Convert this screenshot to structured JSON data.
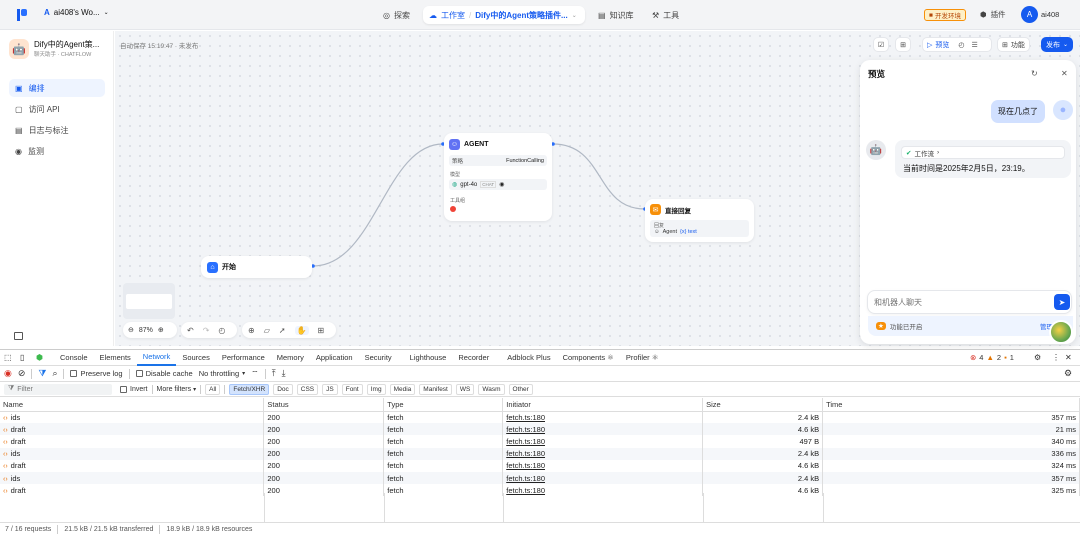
{
  "topbar": {
    "workspace_initial": "A",
    "workspace_name": "ai408's Wo...",
    "nav": [
      {
        "label": "探索"
      },
      {
        "label": "工作室"
      },
      {
        "label": "Dify中的Agent策略插件..."
      },
      {
        "label": "知识库"
      },
      {
        "label": "工具"
      }
    ],
    "env_badge": "开发环境",
    "plugin_label": "插件",
    "user_initial": "A",
    "user_name": "ai408"
  },
  "sidebar": {
    "app_name": "Dify中的Agent策...",
    "app_meta": "聊天助手 · CHATFLOW",
    "items": [
      {
        "label": "编排"
      },
      {
        "label": "访问 API"
      },
      {
        "label": "日志与标注"
      },
      {
        "label": "监测"
      }
    ]
  },
  "canvas": {
    "autosave": "自动保存 15:19:47 · 未发布",
    "toolbar": {
      "preview": "预览",
      "features": "功能",
      "publish": "发布"
    },
    "zoom": "87%",
    "start_node": {
      "title": "开始"
    },
    "agent_node": {
      "title": "AGENT",
      "strategy_label": "策略",
      "strategy_value": "FunctionCalling",
      "model_label": "模型",
      "model_name": "gpt-4o",
      "model_tag": "CHAT",
      "tools_label": "工具组"
    },
    "answer_node": {
      "title": "直接回复",
      "reply_label": "回复",
      "reply_source": "Agent",
      "reply_var": "{x} text"
    }
  },
  "preview": {
    "title": "预览",
    "user_message": "现在几点了",
    "workflow_label": "工作流",
    "bot_reply": "当前时间是2025年2月5日，23:19。",
    "input_placeholder": "和机器人聊天",
    "features_status": "功能已开启",
    "manage_label": "管理"
  },
  "devtools": {
    "tabs": [
      "Console",
      "Elements",
      "Network",
      "Sources",
      "Performance",
      "Memory",
      "Application",
      "Security",
      "Lighthouse",
      "Recorder",
      "Adblock Plus",
      "Components ⚛",
      "Profiler ⚛"
    ],
    "errors": "4",
    "warnings": "2",
    "info": "1",
    "toolbar": {
      "preserve_log": "Preserve log",
      "disable_cache": "Disable cache",
      "throttling": "No throttling"
    },
    "filter": {
      "placeholder": "Filter",
      "invert": "Invert",
      "more_filters": "More filters",
      "chips": [
        "All",
        "Fetch/XHR",
        "Doc",
        "CSS",
        "JS",
        "Font",
        "Img",
        "Media",
        "Manifest",
        "WS",
        "Wasm",
        "Other"
      ]
    },
    "columns": [
      "Name",
      "Status",
      "Type",
      "Initiator",
      "Size",
      "Time"
    ],
    "rows": [
      [
        "ids",
        "200",
        "fetch",
        "fetch.ts:180",
        "2.4 kB",
        "357 ms"
      ],
      [
        "draft",
        "200",
        "fetch",
        "fetch.ts:180",
        "4.6 kB",
        "21 ms"
      ],
      [
        "draft",
        "200",
        "fetch",
        "fetch.ts:180",
        "497 B",
        "340 ms"
      ],
      [
        "ids",
        "200",
        "fetch",
        "fetch.ts:180",
        "2.4 kB",
        "336 ms"
      ],
      [
        "draft",
        "200",
        "fetch",
        "fetch.ts:180",
        "4.6 kB",
        "324 ms"
      ],
      [
        "ids",
        "200",
        "fetch",
        "fetch.ts:180",
        "2.4 kB",
        "357 ms"
      ],
      [
        "draft",
        "200",
        "fetch",
        "fetch.ts:180",
        "4.6 kB",
        "325 ms"
      ]
    ],
    "status": {
      "requests": "7 / 16 requests",
      "transferred": "21.5 kB / 21.5 kB transferred",
      "resources": "18.9 kB / 18.9 kB resources"
    }
  },
  "colors": {
    "accent": "#155aef",
    "canvas_bg": "#f2f4f7",
    "devtools_active": "#1a73e8"
  }
}
